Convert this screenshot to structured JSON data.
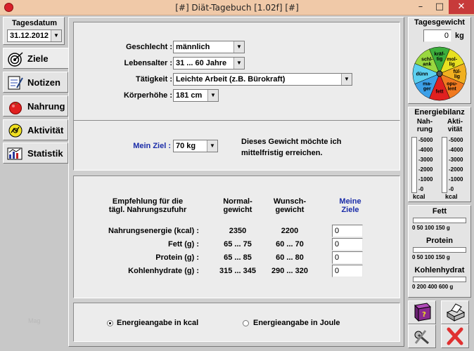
{
  "window": {
    "title": "[#] Diät-Tagebuch [1.02f] [#]",
    "min": "–",
    "max": "□",
    "close": "✕"
  },
  "sidebar": {
    "date_label": "Tagesdatum",
    "date_value": "31.12.2012",
    "items": [
      {
        "label": "Ziele",
        "icon": "target-icon"
      },
      {
        "label": "Notizen",
        "icon": "notepad-icon"
      },
      {
        "label": "Nahrung",
        "icon": "tomato-icon"
      },
      {
        "label": "Aktivität",
        "icon": "sun-icon"
      },
      {
        "label": "Statistik",
        "icon": "chart-icon"
      }
    ],
    "watermark": "Mag"
  },
  "profile": {
    "gender_label": "Geschlecht :",
    "gender_value": "männlich",
    "age_label": "Lebensalter :",
    "age_value": "31 ... 60 Jahre",
    "activity_label": "Tätigkeit :",
    "activity_value": "Leichte Arbeit (z.B. Bürokraft)",
    "height_label": "Körperhöhe :",
    "height_value": "181 cm"
  },
  "goal": {
    "label": "Mein Ziel :",
    "value": "70 kg",
    "note_line1": "Dieses Gewicht möchte ich",
    "note_line2": "mittelfristig erreichen."
  },
  "table": {
    "header_col1_line1": "Empfehlung für die",
    "header_col1_line2": "tägl. Nahrungszufuhr",
    "header_col2_line1": "Normal-",
    "header_col2_line2": "gewicht",
    "header_col3_line1": "Wunsch-",
    "header_col3_line2": "gewicht",
    "header_col4_line1": "Meine",
    "header_col4_line2": "Ziele",
    "rows": [
      {
        "label": "Nahrungsenergie (kcal) :",
        "normal": "2350",
        "wish": "2200",
        "goal": "0"
      },
      {
        "label": "Fett (g) :",
        "normal": "65 ... 75",
        "wish": "60 ... 70",
        "goal": "0"
      },
      {
        "label": "Protein (g) :",
        "normal": "65 ... 85",
        "wish": "60 ... 80",
        "goal": "0"
      },
      {
        "label": "Kohlenhydrate (g) :",
        "normal": "315 ... 345",
        "wish": "290 ... 320",
        "goal": "0"
      }
    ]
  },
  "energy_unit": {
    "option_kcal": "Energieangabe in kcal",
    "option_joule": "Energieangabe in Joule",
    "selected": "kcal"
  },
  "right": {
    "weight_header": "Tagesgewicht",
    "weight_value": "0",
    "weight_unit": "kg",
    "wheel_segments": [
      {
        "label": "kräf-\ntig",
        "color": "#3cae3c"
      },
      {
        "label": "mol-\nlig",
        "color": "#e8e020"
      },
      {
        "label": "fül-\nlig",
        "color": "#f0b020"
      },
      {
        "label": "opu-\nlent",
        "color": "#f07a20"
      },
      {
        "label": "fett",
        "color": "#e02020"
      },
      {
        "label": "ma-\nger",
        "color": "#3ca0e8"
      },
      {
        "label": "dünn",
        "color": "#5cd0f0"
      },
      {
        "label": "schl-\nank",
        "color": "#9ad840"
      }
    ],
    "energy_header": "Energiebilanz",
    "intake_header_line1": "Nah-",
    "intake_header_line2": "rung",
    "activity_header_line1": "Akti-",
    "activity_header_line2": "vität",
    "energy_scale": [
      "-5000",
      "-4000",
      "-3000",
      "-2000",
      "-1000",
      "-0"
    ],
    "energy_unit": "kcal",
    "fat_label": "Fett",
    "fat_scale": "0 50 100 150 g",
    "protein_label": "Protein",
    "protein_scale": "0 50 100 150 g",
    "carb_label": "Kohlenhydrat",
    "carb_scale": "0 200 400 600 g"
  },
  "colors": {
    "title_bar": "#f0c9a8",
    "accent_goal": "#1a2ca8",
    "close": "#c73a3a"
  }
}
